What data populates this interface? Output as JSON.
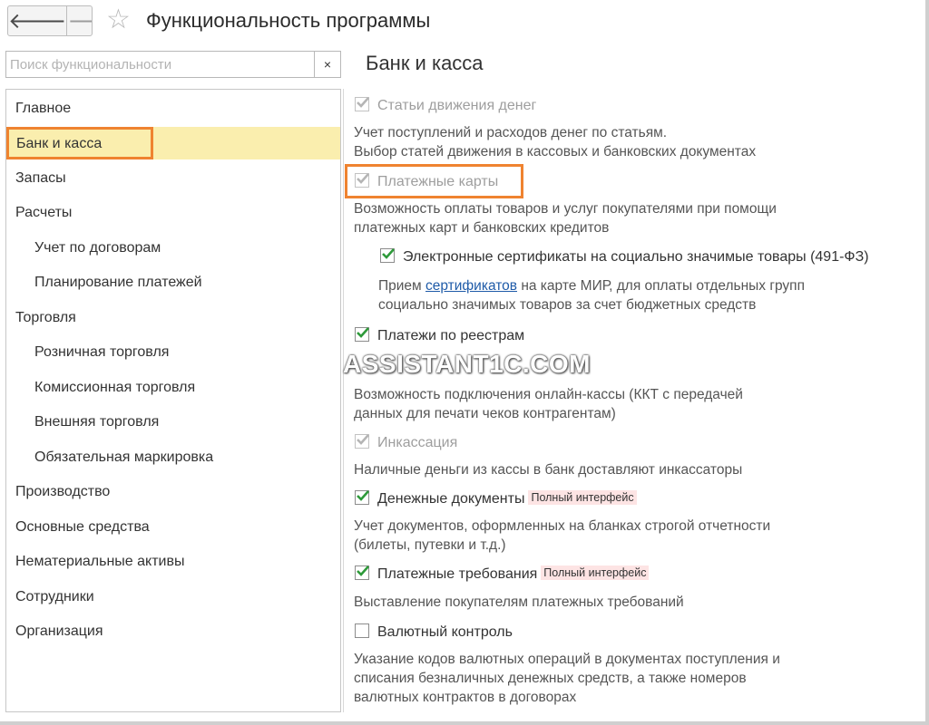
{
  "window": {
    "title": "Функциональность программы",
    "back_icon": "arrow-left",
    "forward_icon": "arrow-right",
    "favorite_icon": "star-outline"
  },
  "search": {
    "placeholder": "Поиск функциональности",
    "value": "",
    "clear_label": "×"
  },
  "sidebar": {
    "selected_index": 1,
    "items": [
      {
        "label": "Главное",
        "level": 0
      },
      {
        "label": "Банк и касса",
        "level": 0
      },
      {
        "label": "Запасы",
        "level": 0
      },
      {
        "label": "Расчеты",
        "level": 0
      },
      {
        "label": "Учет по договорам",
        "level": 1
      },
      {
        "label": "Планирование платежей",
        "level": 1
      },
      {
        "label": "Торговля",
        "level": 0
      },
      {
        "label": "Розничная торговля",
        "level": 1
      },
      {
        "label": "Комиссионная торговля",
        "level": 1
      },
      {
        "label": "Внешняя торговля",
        "level": 1
      },
      {
        "label": "Обязательная маркировка",
        "level": 1
      },
      {
        "label": "Производство",
        "level": 0
      },
      {
        "label": "Основные средства",
        "level": 0
      },
      {
        "label": "Нематериальные активы",
        "level": 0
      },
      {
        "label": "Сотрудники",
        "level": 0
      },
      {
        "label": "Организация",
        "level": 0
      }
    ]
  },
  "main": {
    "title": "Банк и касса",
    "options": [
      {
        "label": "Статьи движения денег",
        "checked": true,
        "enabled": false,
        "desc": [
          "Учет поступлений и расходов денег по статьям.",
          "Выбор статей движения в кассовых и банковских документах"
        ]
      },
      {
        "label": "Платежные карты",
        "checked": true,
        "enabled": false,
        "desc": [
          "Возможность оплаты товаров и услуг покупателями при помощи",
          "платежных карт и банковских кредитов"
        ]
      },
      {
        "label": "Электронные сертификаты на социально значимые товары (491-ФЗ)",
        "checked": true,
        "enabled": true,
        "desc_prefix": "Прием ",
        "desc_link": "сертификатов",
        "desc_suffix": " на карте МИР, для оплаты отдельных групп",
        "desc_line2": "социально значимых товаров за счет бюджетных средств"
      },
      {
        "label": "Платежи по реестрам",
        "checked": true,
        "enabled": true
      },
      {
        "desc": [
          "Возможность подключения онлайн-кассы (ККТ с передачей",
          "данных для печати чеков контрагентам)"
        ]
      },
      {
        "label": "Инкассация",
        "checked": true,
        "enabled": false,
        "desc": [
          "Наличные деньги из кассы в банк доставляют инкассаторы"
        ]
      },
      {
        "label": "Денежные документы",
        "checked": true,
        "enabled": true,
        "badge": "Полный интерфейс",
        "desc": [
          "Учет документов, оформленных на бланках строгой отчетности",
          "(билеты, путевки и т.д.)"
        ]
      },
      {
        "label": "Платежные требования",
        "checked": true,
        "enabled": true,
        "badge": "Полный интерфейс",
        "desc": [
          "Выставление покупателям платежных требований"
        ]
      },
      {
        "label": "Валютный контроль",
        "checked": false,
        "enabled": true,
        "desc": [
          "Указание кодов валютных операций в документах поступления и",
          "списания безналичных денежных средств, а также номеров",
          "валютных контрактов в договорах"
        ]
      }
    ]
  },
  "watermark": "ASSISTANT1C.COM",
  "colors": {
    "selection_bg": "#faeeae",
    "highlight_border": "#ef8330",
    "check_green": "#2e9a3a",
    "link": "#1f5ba8",
    "badge_bg": "#fde4e4"
  }
}
